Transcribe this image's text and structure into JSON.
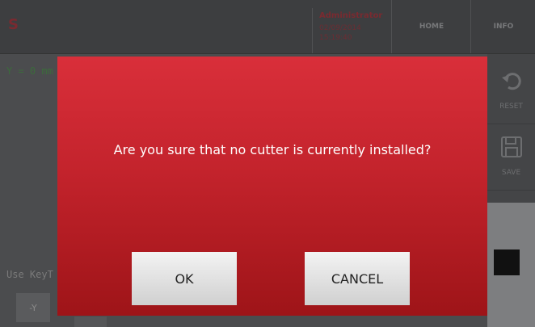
{
  "app": {
    "logo": "S",
    "user": {
      "name": "Administrator",
      "date": "02/09/2014",
      "time": "15:19:40"
    },
    "nav": {
      "home": "HOME",
      "info": "INFO"
    },
    "coordinate_text": "Y = 0 mm",
    "hint_text": "Use KeyT",
    "y_button": "-Y",
    "sidebar": {
      "reset_label": "RESET",
      "reset_icon": "undo-icon",
      "save_label": "SAVE",
      "save_icon": "floppy-disk-icon"
    }
  },
  "dialog": {
    "message": "Are you sure that no cutter is currently installed?",
    "ok_label": "OK",
    "cancel_label": "CANCEL",
    "colors": {
      "top": "#d92f3a",
      "bottom": "#9e1418"
    }
  }
}
